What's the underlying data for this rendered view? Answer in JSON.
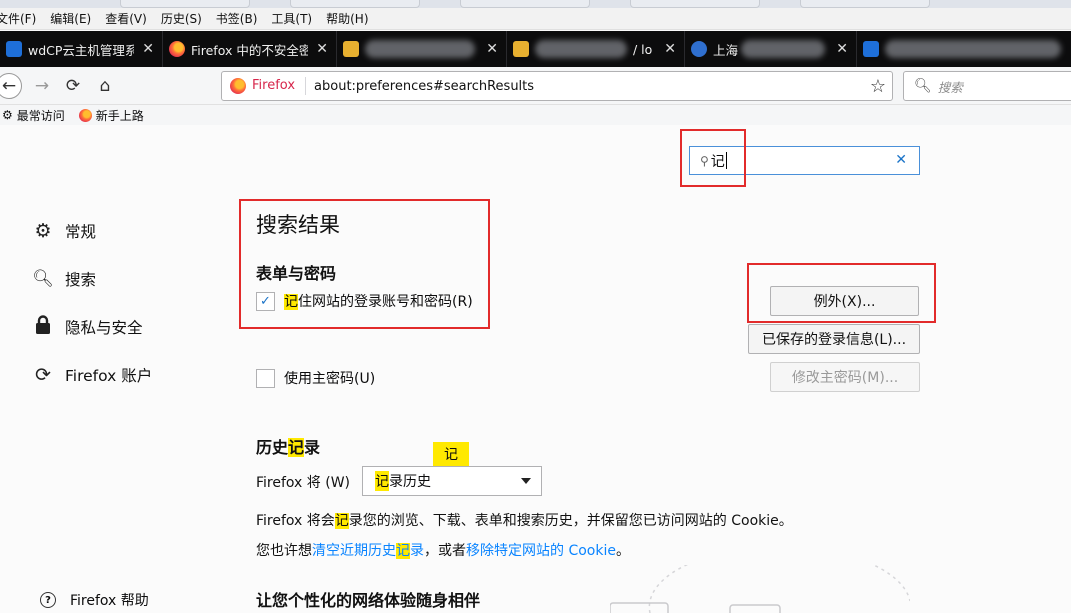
{
  "menu": [
    "文件(F)",
    "编辑(E)",
    "查看(V)",
    "历史(S)",
    "书签(B)",
    "工具(T)",
    "帮助(H)"
  ],
  "tabs": [
    {
      "title": "wdCP云主机管理系统",
      "close": "✕"
    },
    {
      "title": "Firefox 中的不安全密",
      "close": "✕"
    },
    {
      "title": "",
      "close": "✕"
    },
    {
      "title": "/ lo",
      "close": "✕"
    },
    {
      "title": "上海",
      "close": "✕"
    },
    {
      "title": "",
      "close": ""
    }
  ],
  "toolbar": {
    "brand": "Firefox",
    "url": "about:preferences#searchResults",
    "search_placeholder": "搜索"
  },
  "bookmarks": [
    "最常访问",
    "新手上路"
  ],
  "prefs": {
    "search_value": "记",
    "sidebar": [
      "常规",
      "搜索",
      "隐私与安全",
      "Firefox 账户"
    ],
    "help": "Firefox 帮助",
    "heading": "搜索结果",
    "forms_heading": "表单与密码",
    "remember_hl": "记",
    "remember_rest": "住网站的登录账号和密码(R)",
    "exceptions_btn": "例外(X)...",
    "saved_logins_btn": "已保存的登录信息(L)...",
    "master_pw": "使用主密码(U)",
    "change_master_btn": "修改主密码(M)...",
    "history_heading_a": "历史",
    "history_heading_hl": "记",
    "history_heading_b": "录",
    "tooltip": "记",
    "firefox_will": "Firefox 将 (W)",
    "select_hl": "记",
    "select_rest": "录历史",
    "desc1_a": "Firefox 将会",
    "desc1_hl": "记",
    "desc1_b": "录您的浏览、下载、表单和搜索历史，并保留您已访问网站的 Cookie。",
    "desc2_a": "您也许想",
    "desc2_link1_a": "清空近期历史",
    "desc2_link1_hl": "记",
    "desc2_link1_b": "录",
    "desc2_mid": "，或者",
    "desc2_link2": "移除特定网站的 Cookie",
    "desc2_end": "。",
    "personalize_heading": "让您个性化的网络体验随身相伴"
  }
}
